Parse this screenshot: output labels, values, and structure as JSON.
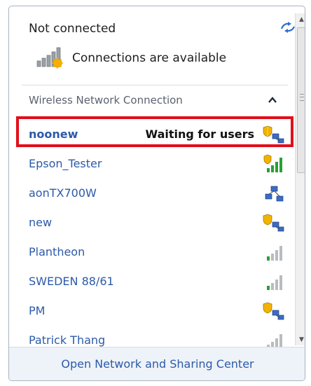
{
  "header": {
    "status_title": "Not connected",
    "availability_text": "Connections are available"
  },
  "section": {
    "title": "Wireless Network Connection"
  },
  "networks": [
    {
      "name": "noonew",
      "status": "Waiting for users",
      "icon": "ad-hoc-shield-icon",
      "selected": true
    },
    {
      "name": "Epson_Tester",
      "status": "",
      "icon": "signal-shield-icon"
    },
    {
      "name": "aonTX700W",
      "status": "",
      "icon": "ad-hoc-icon"
    },
    {
      "name": "new",
      "status": "",
      "icon": "ad-hoc-shield-icon"
    },
    {
      "name": "Plantheon",
      "status": "",
      "icon": "signal-weak-icon"
    },
    {
      "name": "SWEDEN 88/61",
      "status": "",
      "icon": "signal-weak-icon"
    },
    {
      "name": "PM",
      "status": "",
      "icon": "ad-hoc-shield-icon"
    },
    {
      "name": "Patrick Thang",
      "status": "",
      "icon": "signal-faded-icon"
    }
  ],
  "footer": {
    "link_label": "Open Network and Sharing Center"
  },
  "colors": {
    "link": "#2c5aa8",
    "highlight": "#e10f1a",
    "footer_bg": "#eef3f9"
  }
}
